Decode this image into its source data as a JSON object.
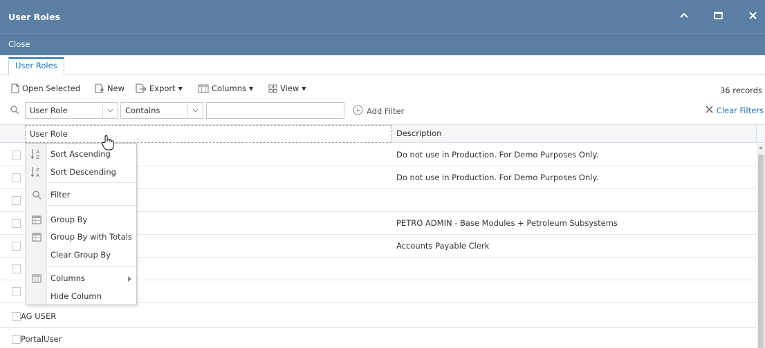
{
  "window": {
    "title": "User Roles",
    "controls": [
      "minimize-icon",
      "maximize-icon",
      "close-icon"
    ]
  },
  "actionbar": {
    "close_label": "Close"
  },
  "tabs": [
    {
      "label": "User Roles",
      "active": true
    }
  ],
  "toolbar": {
    "open_selected": "Open Selected",
    "new": "New",
    "export": "Export",
    "columns": "Columns",
    "view": "View",
    "records": "36 records"
  },
  "filter": {
    "field": "User Role",
    "operator": "Contains",
    "value": "",
    "add_filter": "Add Filter",
    "clear_filters": "Clear Filters"
  },
  "grid": {
    "columns": [
      "User Role",
      "Description"
    ],
    "rows": [
      {
        "role": "",
        "description": "Do not use in Production. For Demo Purposes Only."
      },
      {
        "role": "",
        "description": "Do not use in Production. For Demo Purposes Only."
      },
      {
        "role": "",
        "description": ""
      },
      {
        "role": "",
        "description": "PETRO ADMIN - Base Modules + Petroleum Subsystems"
      },
      {
        "role": "",
        "description": "Accounts Payable Clerk"
      },
      {
        "role": "",
        "description": ""
      },
      {
        "role": "",
        "description": ""
      },
      {
        "role": "AG USER",
        "description": ""
      },
      {
        "role": "PortalUser",
        "description": ""
      }
    ]
  },
  "column_menu": {
    "items": [
      {
        "label": "Sort Ascending",
        "icon": "sort-ascending-icon"
      },
      {
        "label": "Sort Descending",
        "icon": "sort-descending-icon"
      },
      {
        "label": "Filter",
        "icon": "search-icon"
      },
      {
        "label": "Group By",
        "icon": "group-by-icon"
      },
      {
        "label": "Group By with Totals",
        "icon": "group-by-totals-icon"
      },
      {
        "label": "Clear Group By",
        "icon": ""
      },
      {
        "label": "Columns",
        "icon": "columns-icon",
        "submenu": true
      },
      {
        "label": "Hide Column",
        "icon": ""
      }
    ]
  },
  "colors": {
    "titlebar": "#5a7fa3",
    "accent": "#1d6fb7"
  }
}
